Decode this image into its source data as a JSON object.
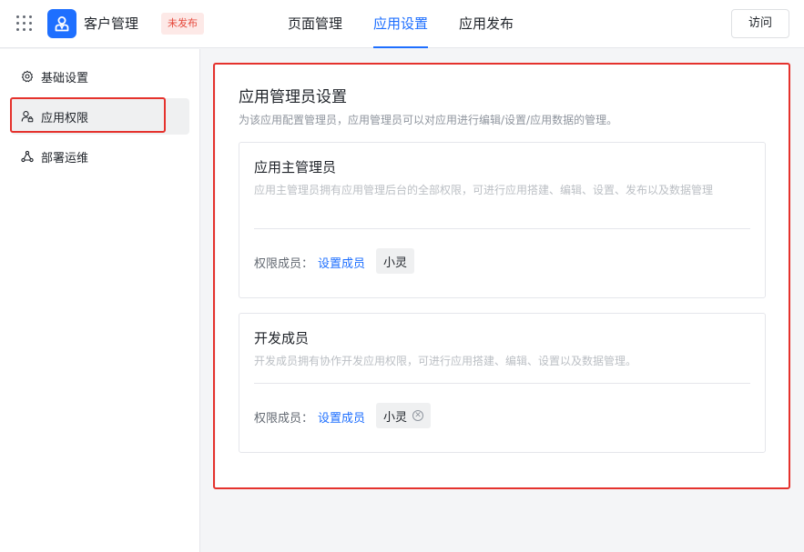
{
  "header": {
    "app_name": "客户管理",
    "status_badge": "未发布",
    "tabs": [
      {
        "label": "页面管理",
        "active": false
      },
      {
        "label": "应用设置",
        "active": true
      },
      {
        "label": "应用发布",
        "active": false
      }
    ],
    "visit_label": "访问"
  },
  "sidebar": {
    "items": [
      {
        "label": "基础设置",
        "icon": "gear-icon",
        "active": false
      },
      {
        "label": "应用权限",
        "icon": "user-lock-icon",
        "active": true
      },
      {
        "label": "部署运维",
        "icon": "network-nodes-icon",
        "active": false
      }
    ]
  },
  "main": {
    "title": "应用管理员设置",
    "description": "为该应用配置管理员，应用管理员可以对应用进行编辑/设置/应用数据的管理。",
    "cards": [
      {
        "title": "应用主管理员",
        "description": "应用主管理员拥有应用管理后台的全部权限，可进行应用搭建、编辑、设置、发布以及数据管理",
        "member_label": "权限成员：",
        "set_link": "设置成员",
        "members": [
          "小灵"
        ],
        "removable": false
      },
      {
        "title": "开发成员",
        "description": "开发成员拥有协作开发应用权限，可进行应用搭建、编辑、设置以及数据管理。",
        "member_label": "权限成员：",
        "set_link": "设置成员",
        "members": [
          "小灵"
        ],
        "removable": true
      }
    ]
  },
  "colors": {
    "accent": "#1e6fff",
    "highlight_border": "#e5322d",
    "badge_bg": "#fde9e7",
    "badge_text": "#e5483b"
  }
}
